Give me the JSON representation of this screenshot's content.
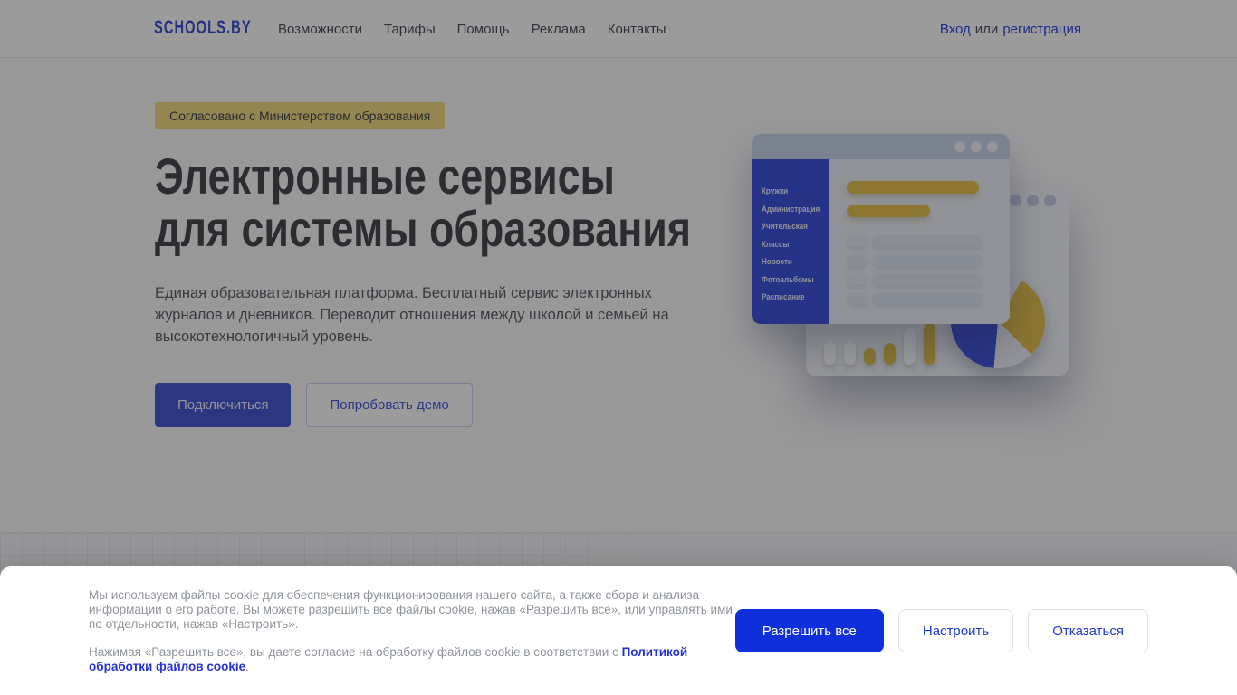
{
  "header": {
    "logo": "SCHOOLS.BY",
    "nav": [
      "Возможности",
      "Тарифы",
      "Помощь",
      "Реклама",
      "Контакты"
    ],
    "auth": {
      "login": "Вход",
      "or": "или",
      "register": "регистрация"
    }
  },
  "hero": {
    "badge": "Согласовано с Министерством образования",
    "title_line1": "Электронные сервисы",
    "title_line2": "для системы образования",
    "description": "Единая образовательная платформа. Бесплатный сервис электронных журналов и дневников. Переводит отношения между школой и семьей на высокотехнологичный уровень.",
    "cta_primary": "Подключиться",
    "cta_secondary": "Попробовать демо"
  },
  "illustration": {
    "menu_items": [
      "Кружки",
      "Администрация",
      "Учительская",
      "Классы",
      "Новости",
      "Фотоальбомы",
      "Расписание"
    ]
  },
  "cookie_banner": {
    "paragraph1": "Мы используем файлы cookie для обеспечения функционирования нашего сайта, а также сбора и анализа информации о его работе. Вы можете разрешить все файлы cookie, нажав «Разрешить все», или управлять ими по отдельности, нажав «Настроить».",
    "paragraph2_prefix": "Нажимая «Разрешить все», вы даете согласие на обработку файлов cookie в соответствии с ",
    "paragraph2_link": "Политикой обработки файлов cookie",
    "paragraph2_suffix": ".",
    "buttons": {
      "allow": "Разрешить все",
      "configure": "Настроить",
      "decline": "Отказаться"
    }
  },
  "colors": {
    "accent_blue": "#0e2fd9",
    "brand_blue": "#3a4fd8",
    "badge_yellow": "#f4da82",
    "sidebar_blue": "#3f53dd",
    "chart_yellow": "#e6c14b",
    "overlay": "rgba(5,5,8,0.40)"
  }
}
